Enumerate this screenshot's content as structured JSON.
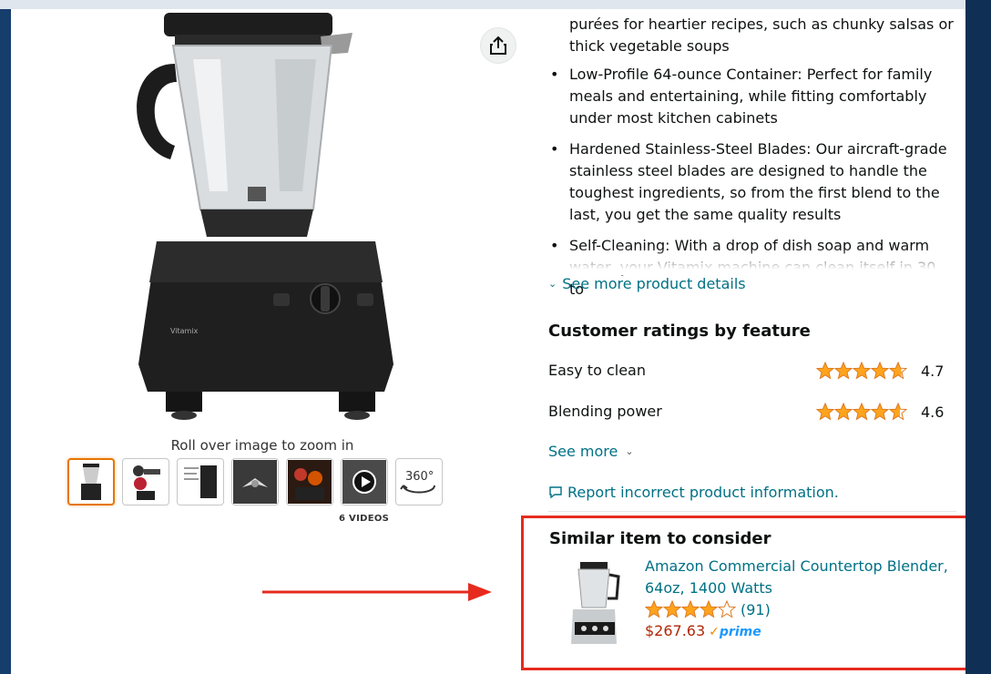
{
  "gallery": {
    "zoom_hint": "Roll over image to zoom in",
    "videos_label": "6 VIDEOS",
    "rotate_label": "360°"
  },
  "description": {
    "top_text": "purées for heartier recipes, such as chunky salsas or thick vegetable soups",
    "bullets": [
      {
        "text": "Low-Profile 64-ounce Container: Perfect for family meals and entertaining, while fitting comfortably under most kitchen cabinets"
      },
      {
        "text": "Hardened Stainless-Steel Blades: Our aircraft-grade stainless steel blades are designed to handle the toughest ingredients, so from the first blend to the last, you get the same quality results"
      },
      {
        "text": "Self-Cleaning: With a drop of dish soap and warm water, your Vitamix machine can clean itself in 30 to"
      }
    ],
    "see_more_details": "See more product details"
  },
  "ratings": {
    "title": "Customer ratings by feature",
    "items": [
      {
        "name": "Easy to clean",
        "score": "4.7",
        "stars": 4.7
      },
      {
        "name": "Blending power",
        "score": "4.6",
        "stars": 4.6
      }
    ],
    "see_more": "See more"
  },
  "report_link": "Report incorrect product information.",
  "similar": {
    "title": "Similar item to consider",
    "product_name": "Amazon Commercial Countertop Blender, 64oz, 1400 Watts",
    "stars": 4.0,
    "review_count": "(91)",
    "price": "$267.63",
    "prime_label": "prime"
  },
  "colors": {
    "link": "#007185",
    "star": "#ffa41c",
    "price": "#b12704",
    "highlight": "#e62b1e",
    "thumb_active": "#e77600"
  }
}
